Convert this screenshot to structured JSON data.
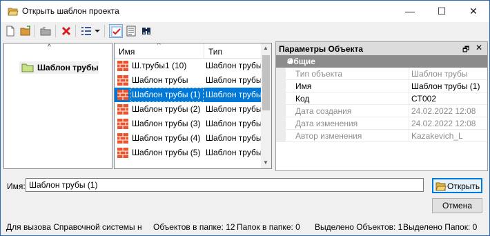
{
  "window": {
    "title": "Открыть шаблон проекта",
    "controls": {
      "minimize": "—",
      "maximize": "☐",
      "close": "✕"
    }
  },
  "toolbar": {
    "buttons": [
      "new-document-icon",
      "open-folder-icon",
      "folder-up-icon",
      "delete-icon",
      "view-list-icon",
      "dropdown-arrow-icon",
      "checked-view-icon",
      "details-icon",
      "find-icon"
    ]
  },
  "tree": {
    "scroll_up": "^",
    "items": [
      {
        "label": "Шаблон трубы"
      }
    ]
  },
  "list": {
    "columns": {
      "name": "Имя",
      "type": "Тип"
    },
    "sort_indicator": "^",
    "rows": [
      {
        "name": "Ш.трубы1 (10)",
        "type": "Шаблон трубы",
        "selected": false
      },
      {
        "name": "Шаблон трубы",
        "type": "Шаблон трубы",
        "selected": false
      },
      {
        "name": "Шаблон трубы (1)",
        "type": "Шаблон трубы",
        "selected": true
      },
      {
        "name": "Шаблон трубы (2)",
        "type": "Шаблон трубы",
        "selected": false
      },
      {
        "name": "Шаблон трубы (3)",
        "type": "Шаблон трубы",
        "selected": false
      },
      {
        "name": "Шаблон трубы (4)",
        "type": "Шаблон трубы",
        "selected": false
      },
      {
        "name": "Шаблон трубы (5)",
        "type": "Шаблон трубы",
        "selected": false
      }
    ],
    "scrollbar": {
      "up": "▲",
      "down": "▼"
    }
  },
  "properties": {
    "title": "Параметры Объекта",
    "pin": "🗗",
    "close": "✕",
    "group": "Общие",
    "group_toggle": "◢",
    "rows": [
      {
        "key": "Тип объекта",
        "value": "Шаблон трубы",
        "readonly": true
      },
      {
        "key": "Имя",
        "value": "Шаблон трубы (1)",
        "readonly": false
      },
      {
        "key": "Код",
        "value": "CT002",
        "readonly": false
      },
      {
        "key": "Дата создания",
        "value": "24.02.2022 12:08",
        "readonly": true
      },
      {
        "key": "Дата изменения",
        "value": "24.02.2022 12:08",
        "readonly": true
      },
      {
        "key": "Автор изменения",
        "value": "Kazakevich_L",
        "readonly": true
      }
    ]
  },
  "name_field": {
    "label": "Имя:",
    "value": "Шаблон трубы (1)"
  },
  "buttons": {
    "open": "Открыть",
    "cancel": "Отмена"
  },
  "status": {
    "help": "Для вызова Справочной системы н",
    "objects": "Объектов в папке: 12",
    "folders": "Папок в папке: 0",
    "selected_objects": "Выделено Объектов: 1",
    "selected_folders": "Выделено Папок: 0"
  },
  "colors": {
    "selection": "#0078d7",
    "group_header": "#8c8c8c",
    "brick": "#e8542e",
    "folder": "#c9e08a"
  }
}
